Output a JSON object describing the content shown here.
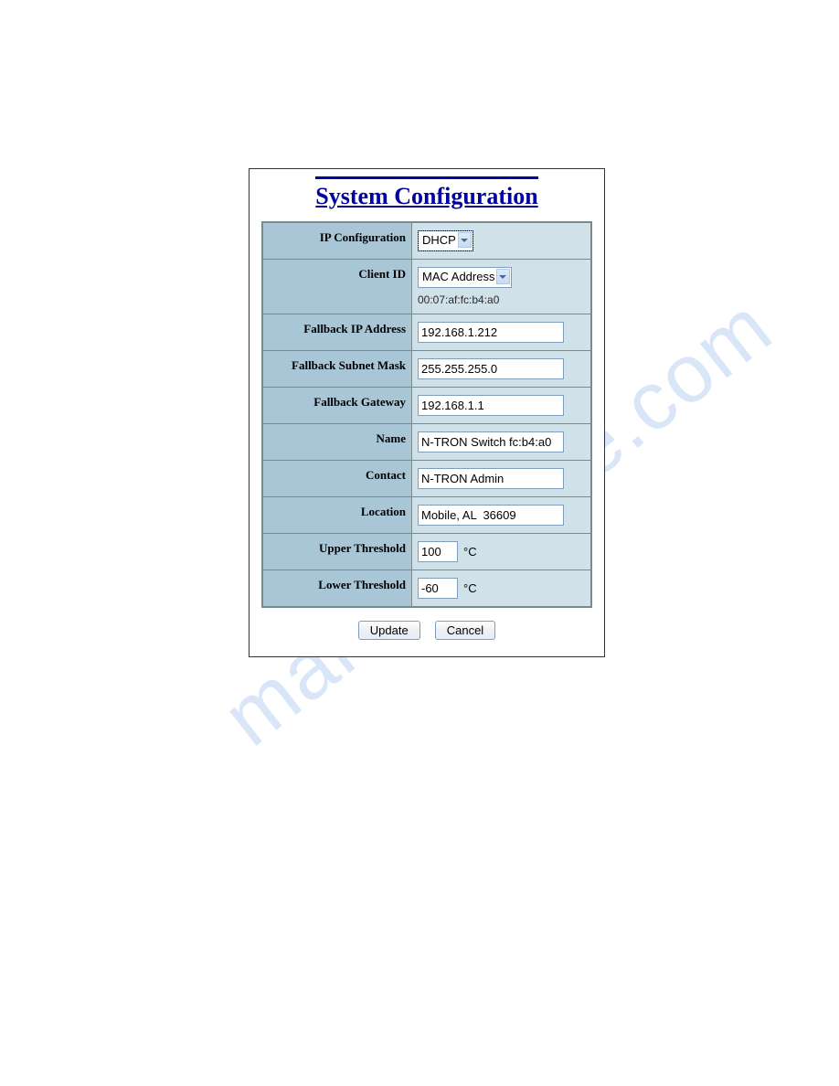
{
  "title": "System Configuration",
  "rows": {
    "ip_config": {
      "label": "IP Configuration",
      "value": "DHCP"
    },
    "client_id": {
      "label": "Client ID",
      "value": "MAC Address",
      "sub": "00:07:af:fc:b4:a0"
    },
    "fallback_ip": {
      "label": "Fallback IP Address",
      "value": "192.168.1.212"
    },
    "fallback_mask": {
      "label": "Fallback Subnet Mask",
      "value": "255.255.255.0"
    },
    "fallback_gw": {
      "label": "Fallback Gateway",
      "value": "192.168.1.1"
    },
    "name": {
      "label": "Name",
      "value": "N-TRON Switch fc:b4:a0"
    },
    "contact": {
      "label": "Contact",
      "value": "N-TRON Admin"
    },
    "location": {
      "label": "Location",
      "value": "Mobile, AL  36609"
    },
    "upper": {
      "label": "Upper Threshold",
      "value": "100",
      "unit": "°C"
    },
    "lower": {
      "label": "Lower Threshold",
      "value": "-60",
      "unit": "°C"
    }
  },
  "buttons": {
    "update": "Update",
    "cancel": "Cancel"
  },
  "watermark": "manualshive.com"
}
